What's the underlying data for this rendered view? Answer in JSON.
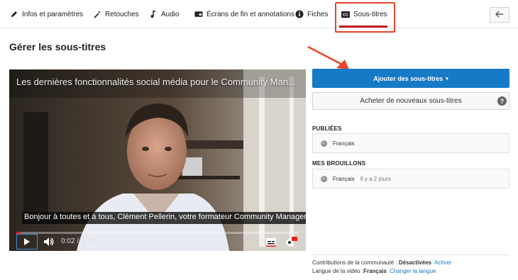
{
  "tabs": [
    {
      "id": "info",
      "label": "Infos et paramètres",
      "icon": "pencil-icon"
    },
    {
      "id": "retouches",
      "label": "Retouches",
      "icon": "magic-wand-icon"
    },
    {
      "id": "audio",
      "label": "Audio",
      "icon": "music-note-icon"
    },
    {
      "id": "endscreens",
      "label": "Écrans de fin et annotations",
      "icon": "end-screen-icon"
    },
    {
      "id": "fiches",
      "label": "Fiches",
      "icon": "info-circle-icon"
    },
    {
      "id": "subtitles",
      "label": "Sous-titres",
      "icon": "cc-icon",
      "active": true
    }
  ],
  "page_title": "Gérer les sous-titres",
  "video": {
    "title": "Les dernières fonctionnalités social média pour le Community Man...",
    "caption": "Bonjour à toutes et à tous, Clément Pellerin, votre formateur Community Manager.",
    "current_time": "0:02",
    "separator": "/",
    "duration": "2:13",
    "progress": 0.016
  },
  "right": {
    "add_button": "Ajouter des sous-titres",
    "add_caret": "▾",
    "buy_button": "Acheter de nouveaux sous-titres",
    "help": "?",
    "published_label": "PUBLIÉES",
    "published_track": "Français",
    "drafts_label": "MES BROUILLONS",
    "draft_track": "Français",
    "draft_meta": "Il y a 2 jours",
    "community_label": "Contributions de la communauté : ",
    "community_value": "Désactivées",
    "community_link": "Activer",
    "language_label": "Langue de la vidéo :",
    "language_value": "Français",
    "language_link": "Changer la langue"
  },
  "colors": {
    "accent_blue": "#167ac6",
    "annotation_red": "#e8452b",
    "tab_underline": "#cc181e"
  }
}
